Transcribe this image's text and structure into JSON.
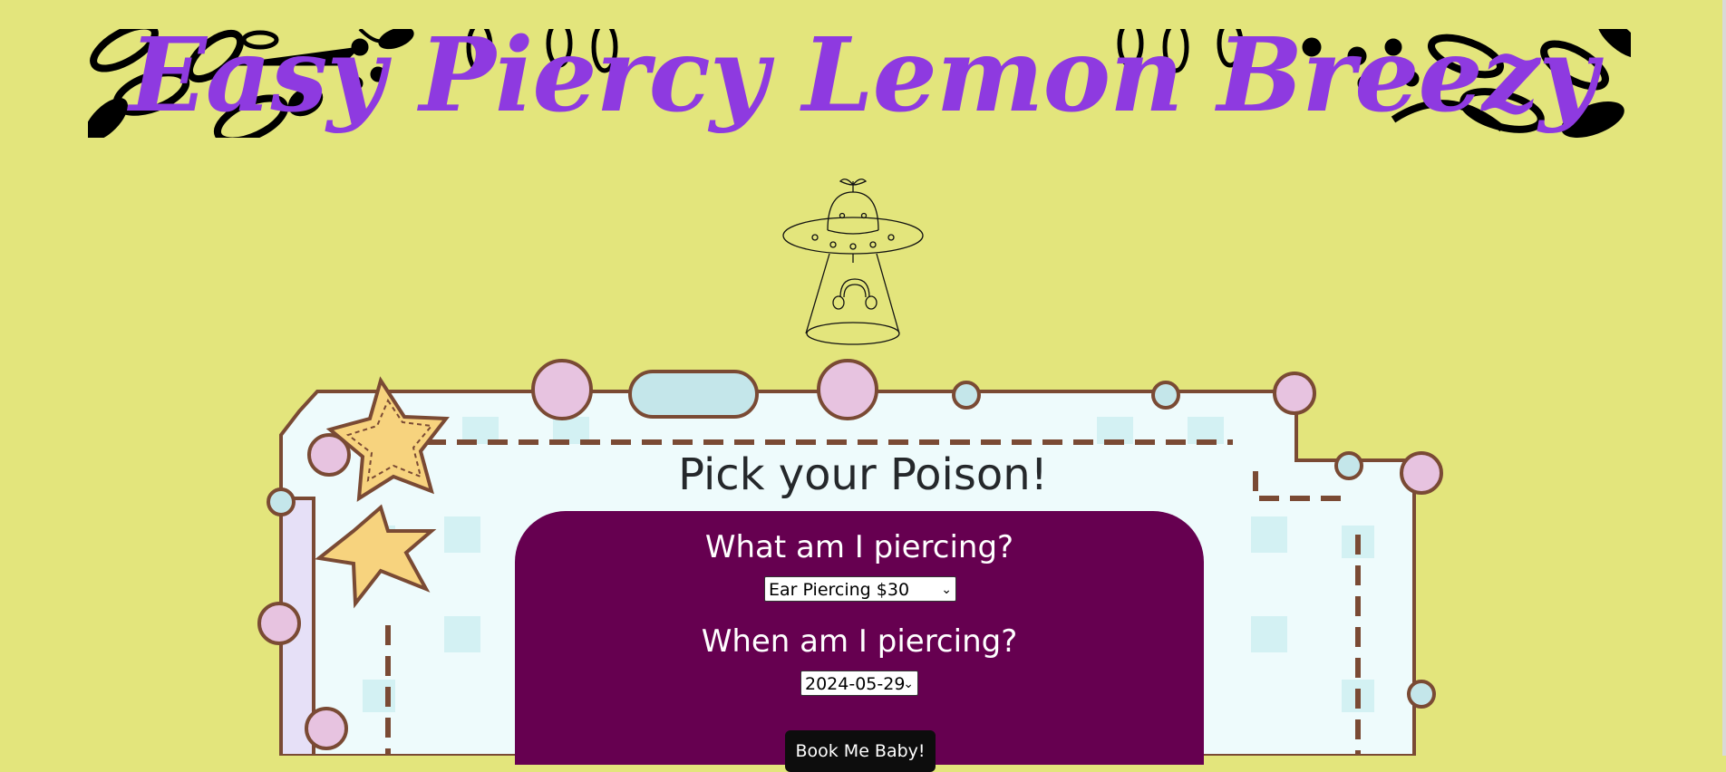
{
  "site_title": "Easy Piercy Lemon Breezy",
  "heading": "Pick your Poison!",
  "form": {
    "piercing_question": "What am I piercing?",
    "piercing_selected": "Ear Piercing $30",
    "date_question": "When am I piercing?",
    "date_selected": "2024-05-29",
    "submit_label": "Book Me Baby!"
  },
  "colors": {
    "background": "#e3e57c",
    "title": "#8e3ae0",
    "panel": "#660050",
    "button": "#0d0d0d"
  },
  "icons": {
    "logo": "ufo-icon",
    "dropdown": "chevron-down-icon"
  }
}
